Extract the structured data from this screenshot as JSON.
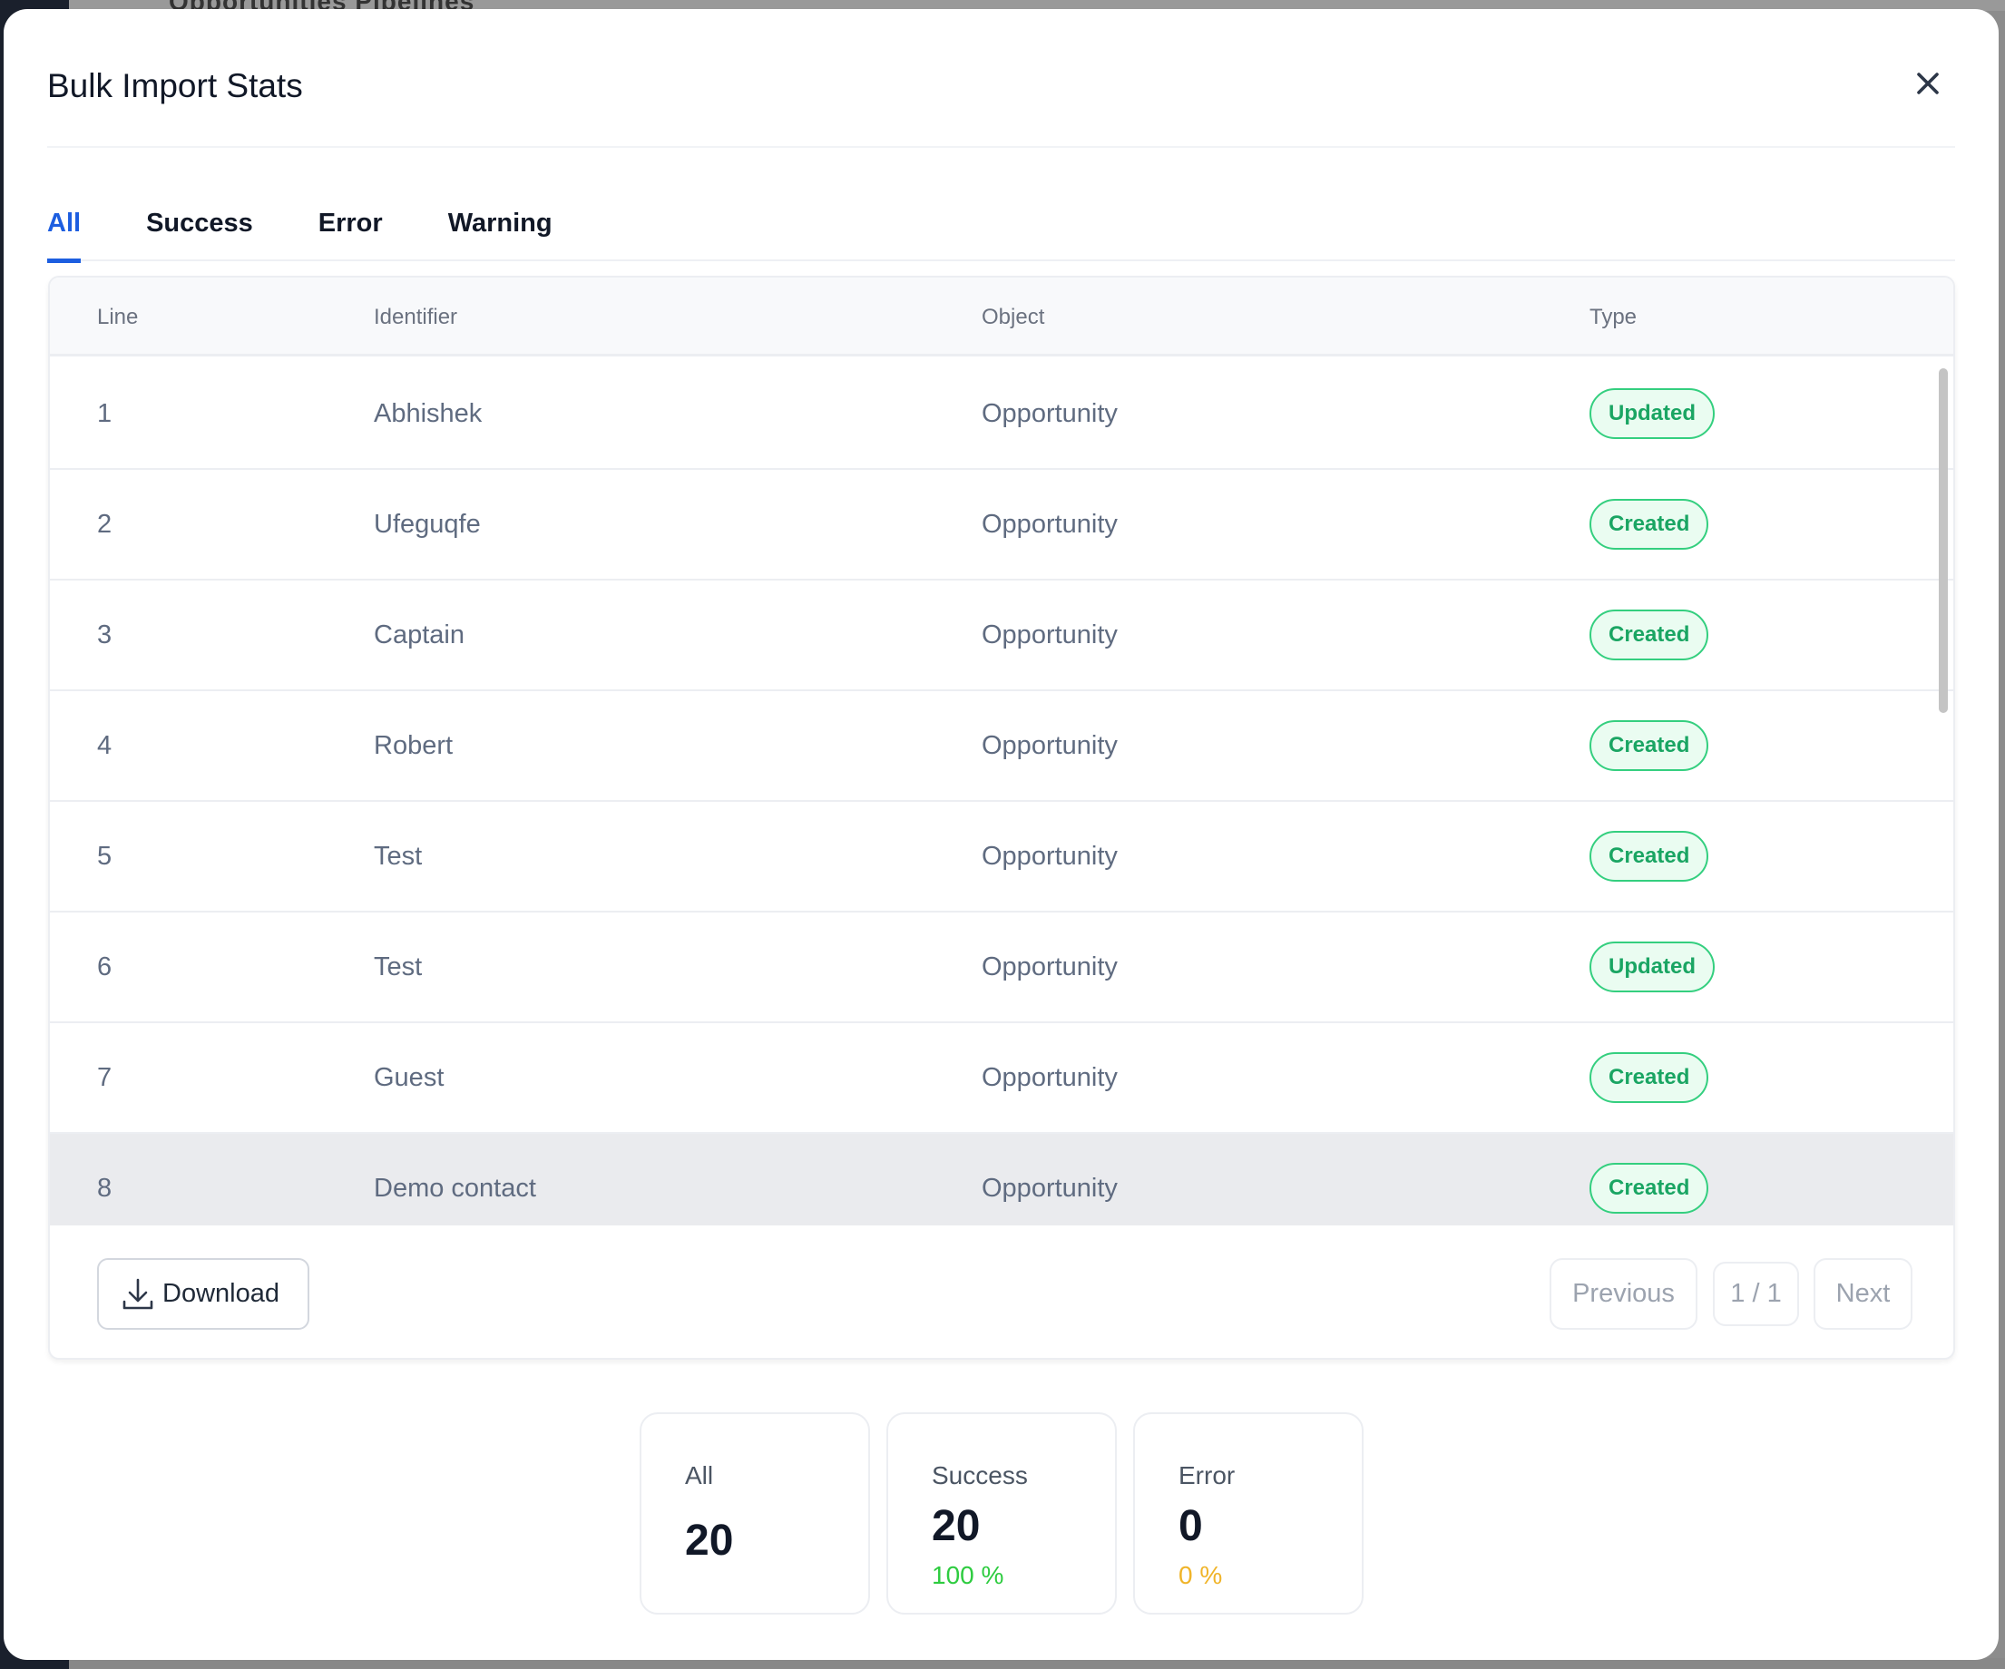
{
  "background": {
    "breadcrumb": "Opportunities    Pipelines"
  },
  "modal": {
    "title": "Bulk Import Stats",
    "close_icon": "close-icon"
  },
  "tabs": [
    {
      "label": "All",
      "active": true
    },
    {
      "label": "Success",
      "active": false
    },
    {
      "label": "Error",
      "active": false
    },
    {
      "label": "Warning",
      "active": false
    }
  ],
  "table": {
    "columns": [
      "Line",
      "Identifier",
      "Object",
      "Type"
    ],
    "rows": [
      {
        "line": "1",
        "identifier": "Abhishek",
        "object": "Opportunity",
        "type": "Updated"
      },
      {
        "line": "2",
        "identifier": "Ufeguqfe",
        "object": "Opportunity",
        "type": "Created"
      },
      {
        "line": "3",
        "identifier": "Captain",
        "object": "Opportunity",
        "type": "Created"
      },
      {
        "line": "4",
        "identifier": "Robert",
        "object": "Opportunity",
        "type": "Created"
      },
      {
        "line": "5",
        "identifier": "Test",
        "object": "Opportunity",
        "type": "Created"
      },
      {
        "line": "6",
        "identifier": "Test",
        "object": "Opportunity",
        "type": "Updated"
      },
      {
        "line": "7",
        "identifier": "Guest",
        "object": "Opportunity",
        "type": "Created"
      },
      {
        "line": "8",
        "identifier": "Demo contact",
        "object": "Opportunity",
        "type": "Created"
      }
    ],
    "hovered_row": 8
  },
  "footer": {
    "download_label": "Download",
    "download_icon": "download-icon",
    "previous_label": "Previous",
    "page_indicator": "1 / 1",
    "next_label": "Next"
  },
  "stats": {
    "all": {
      "label": "All",
      "value": "20"
    },
    "success": {
      "label": "Success",
      "value": "20",
      "percent": "100 %"
    },
    "error": {
      "label": "Error",
      "value": "0",
      "percent": "0 %"
    }
  },
  "colors": {
    "accent": "#1d5ee0",
    "badge_green": "#1aa563",
    "success_pct": "#2ecc40",
    "error_pct": "#f0b429"
  }
}
